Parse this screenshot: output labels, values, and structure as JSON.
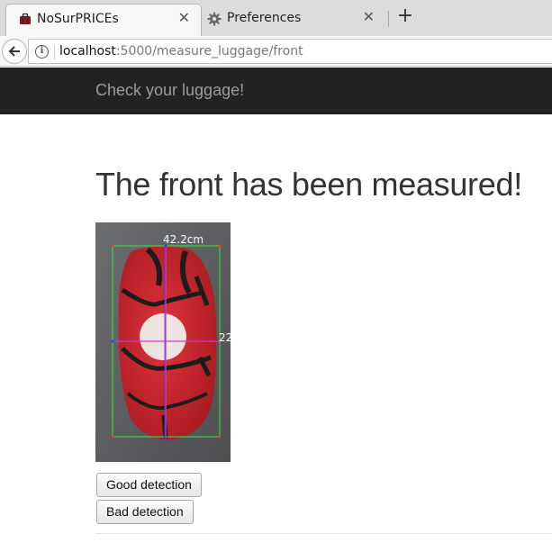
{
  "browser": {
    "tabs": [
      {
        "title": "NoSurPRICEs",
        "icon": "suitcase-favicon",
        "active": true
      },
      {
        "title": "Preferences",
        "icon": "gear-icon",
        "active": false
      }
    ],
    "url": {
      "host": "localhost",
      "path": ":5000/measure_luggage/front"
    }
  },
  "app": {
    "brand": "Check your luggage!"
  },
  "main": {
    "title": "The front has been measured!",
    "image": {
      "width_label": "42.2cm",
      "height_label": "22"
    },
    "buttons": {
      "good": "Good detection",
      "bad": "Bad detection"
    }
  }
}
